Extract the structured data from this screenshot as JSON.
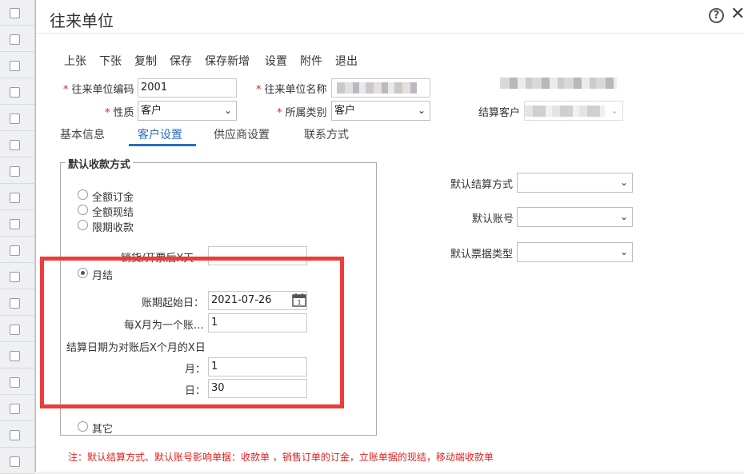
{
  "dialog": {
    "title": "往来单位"
  },
  "toolbar": {
    "prev": "上张",
    "next": "下张",
    "copy": "复制",
    "save": "保存",
    "save_new": "保存新增",
    "settings": "设置",
    "attachment": "附件",
    "exit": "退出"
  },
  "header_form": {
    "code_label": "往来单位编码",
    "code_value": "2001",
    "name_label": "往来单位名称",
    "nature_label": "性质",
    "nature_value": "客户",
    "category_label": "所属类别",
    "category_value": "客户",
    "settle_client_label": "结算客户"
  },
  "tabs": [
    {
      "label": "基本信息"
    },
    {
      "label": "客户设置"
    },
    {
      "label": "供应商设置"
    },
    {
      "label": "联系方式"
    }
  ],
  "receipt_method": {
    "legend": "默认收款方式",
    "options": {
      "full_deposit": "全额订金",
      "full_cash": "全额现结",
      "term": "限期收款",
      "monthly": "月结",
      "other": "其它"
    },
    "term_days_label": "销货/开票后X天",
    "term_days_value": "",
    "start_date_label": "账期起始日：",
    "start_date_value": "2021-07-26",
    "months_per_period_label": "每X月为一个账…",
    "months_per_period_value": "1",
    "settle_rule_label": "结算日期为对账后X个月的X日",
    "month_label": "月：",
    "month_value": "1",
    "day_label": "日：",
    "day_value": "30"
  },
  "right_settings": {
    "settle_method_label": "默认结算方式",
    "account_label": "默认账号",
    "invoice_type_label": "默认票据类型"
  },
  "icons": {
    "help": "help-icon",
    "close": "close-icon",
    "calendar": "calendar-icon",
    "dropdown": "chevron-down-icon"
  },
  "colors": {
    "accent": "#2b6cc4",
    "required": "#e02020",
    "highlight": "#ee3b3b"
  },
  "note": "注：默认结算方式、默认账号影响单据：收款单 ，销售订单的订金，立账单据的现结，移动端收款单"
}
